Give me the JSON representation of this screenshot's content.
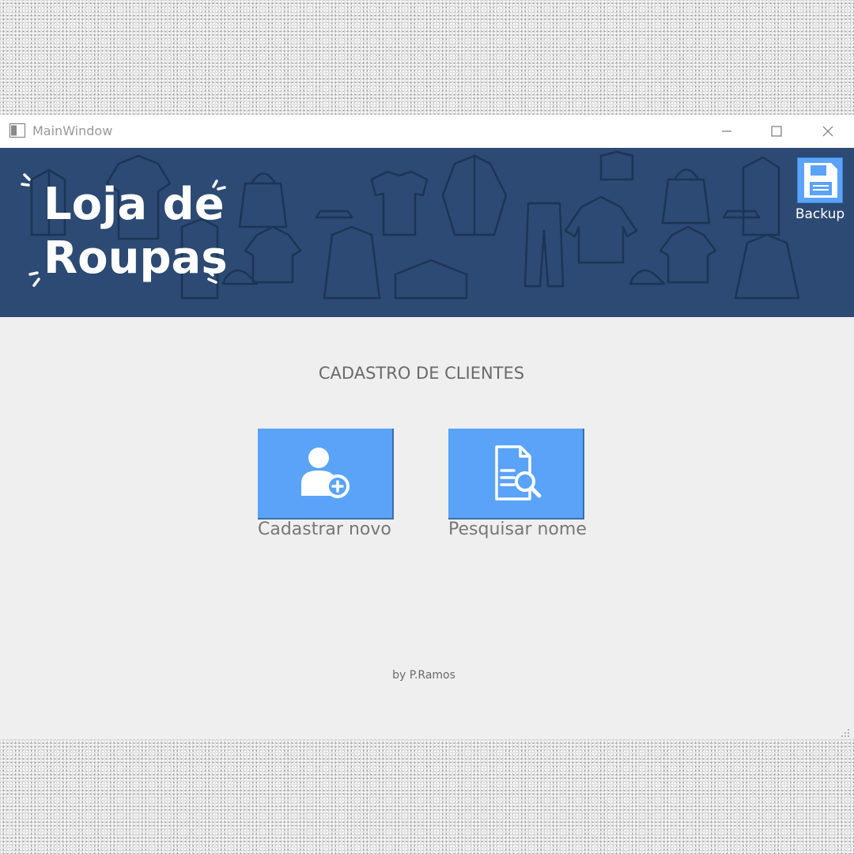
{
  "window": {
    "title": "MainWindow"
  },
  "banner": {
    "brand_line1": "Loja de",
    "brand_line2": "Roupas",
    "backup_label": "Backup",
    "bg_color": "#2c4a73"
  },
  "main": {
    "heading": "CADASTRO DE CLIENTES",
    "actions": [
      {
        "label": "Cadastrar novo",
        "icon": "add-user-icon"
      },
      {
        "label": "Pesquisar nome",
        "icon": "document-search-icon"
      }
    ],
    "credit": "by P.Ramos"
  },
  "colors": {
    "accent": "#5aa3f8",
    "banner": "#2c4a73",
    "background": "#efefef"
  }
}
